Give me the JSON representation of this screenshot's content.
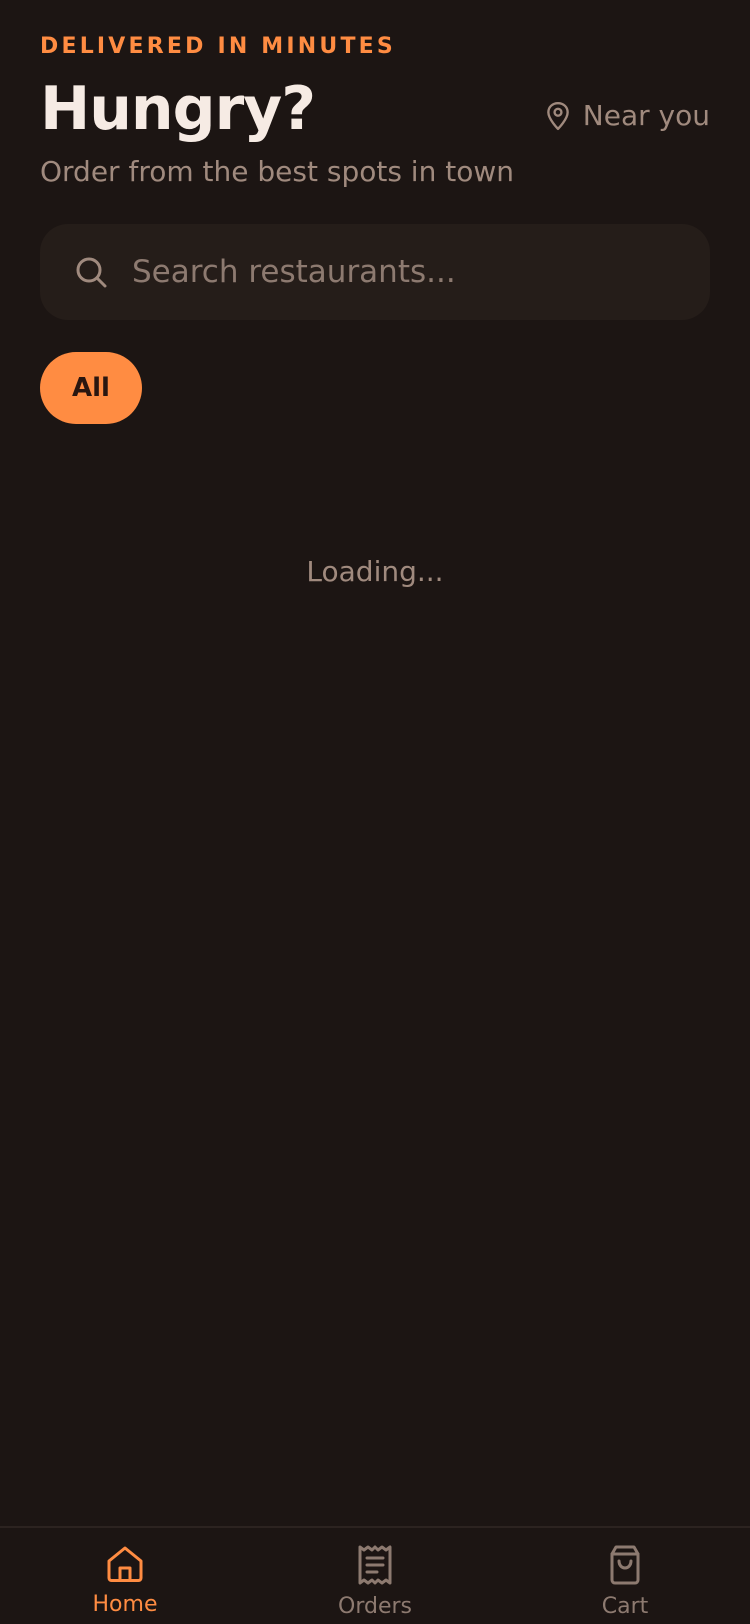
{
  "header": {
    "eyebrow": "DELIVERED IN MINUTES",
    "title": "Hungry?",
    "subtitle": "Order from the best spots in town",
    "location_label": "Near you",
    "location_icon": "map-pin-icon"
  },
  "search": {
    "placeholder": "Search restaurants...",
    "value": "",
    "icon": "search-icon"
  },
  "filters": {
    "chips": [
      {
        "label": "All",
        "selected": true
      }
    ]
  },
  "main": {
    "status_text": "Loading..."
  },
  "tabbar": {
    "tabs": [
      {
        "label": "Home",
        "icon": "home-icon",
        "active": true
      },
      {
        "label": "Orders",
        "icon": "receipt-icon",
        "active": false
      },
      {
        "label": "Cart",
        "icon": "shopping-bag-icon",
        "active": false
      }
    ]
  },
  "colors": {
    "background": "#1c1513",
    "accent": "#ff8c42",
    "surface": "#251d19",
    "text_primary": "#f6ebe4",
    "text_muted": "#a08a7e"
  }
}
